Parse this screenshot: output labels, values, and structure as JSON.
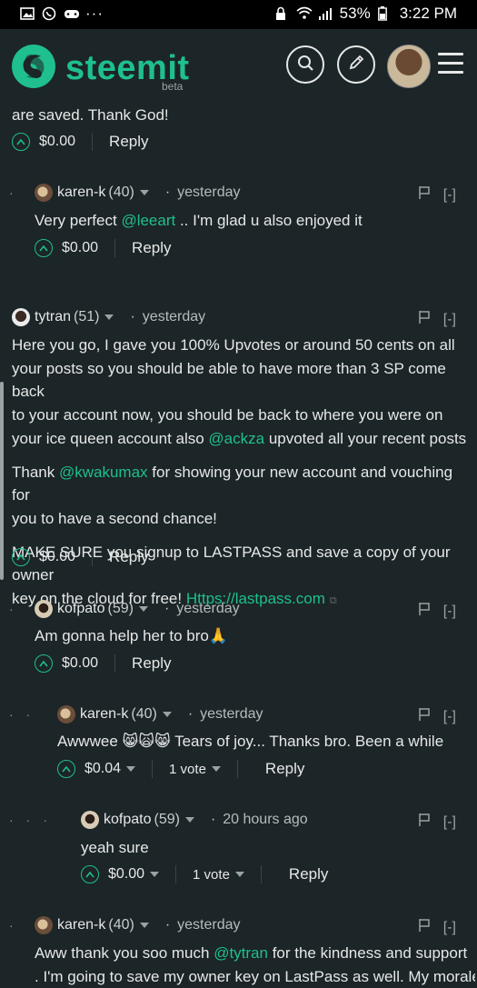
{
  "status": {
    "battery": "53%",
    "time": "3:22 PM"
  },
  "brand": {
    "name": "steemit",
    "tag": "beta"
  },
  "comments": [
    {
      "id": "c0",
      "text_tail": "are saved. Thank God!",
      "amount": "$0.00",
      "reply": "Reply"
    },
    {
      "id": "c1",
      "author": "karen-k",
      "rep": "(40)",
      "time": "yesterday",
      "flag": "[-]",
      "body_pre": "Very perfect ",
      "mention": "@leeart",
      "body_post": " .. I'm glad u also enjoyed it",
      "amount": "$0.00",
      "reply": "Reply"
    },
    {
      "id": "c2",
      "author": "tytran",
      "rep": "(51)",
      "time": "yesterday",
      "flag": "[-]",
      "p1_lines": [
        "Here you go, I gave you 100% Upvotes or around 50 cents on all",
        "your posts so you should be able to have more than 3 SP come back",
        "to your account now, you should be back to where you were on"
      ],
      "p1_last_pre": "your ice queen account also ",
      "p1_mention": "@ackza",
      "p1_last_post": " upvoted all your recent posts",
      "p2_pre": "Thank ",
      "p2_mention": "@kwakumax",
      "p2_post": " for showing your new account and vouching for",
      "p2_line2": "you to have a second chance!",
      "p3_line1": "MAKE SURE you signup to LASTPASS and save a copy of your owner",
      "p3_line2_pre": "key on the cloud for free! ",
      "p3_link": "Https://lastpass.com",
      "amount": "$0.00",
      "reply": "Reply"
    },
    {
      "id": "c3",
      "author": "kofpato",
      "rep": "(59)",
      "time": "yesterday",
      "flag": "[-]",
      "body": "Am gonna help her to bro🙏",
      "amount": "$0.00",
      "reply": "Reply"
    },
    {
      "id": "c4",
      "author": "karen-k",
      "rep": "(40)",
      "time": "yesterday",
      "flag": "[-]",
      "body": "Awwwee 😸🙀😸 Tears of joy... Thanks bro. Been a while",
      "amount": "$0.04",
      "votes": "1 vote",
      "reply": "Reply"
    },
    {
      "id": "c5",
      "author": "kofpato",
      "rep": "(59)",
      "time": "20 hours ago",
      "flag": "[-]",
      "body": "yeah sure",
      "amount": "$0.00",
      "votes": "1 vote",
      "reply": "Reply"
    },
    {
      "id": "c6",
      "author": "karen-k",
      "rep": "(40)",
      "time": "yesterday",
      "flag": "[-]",
      "body_pre": "Aww thank you soo much ",
      "mention": "@tytran",
      "body_post": " for the kindness and support",
      "line2": ". I'm going to save my owner key on LastPass as well. My morale"
    }
  ],
  "colors": {
    "accent": "#1fbf8f",
    "background": "#1c2527"
  }
}
